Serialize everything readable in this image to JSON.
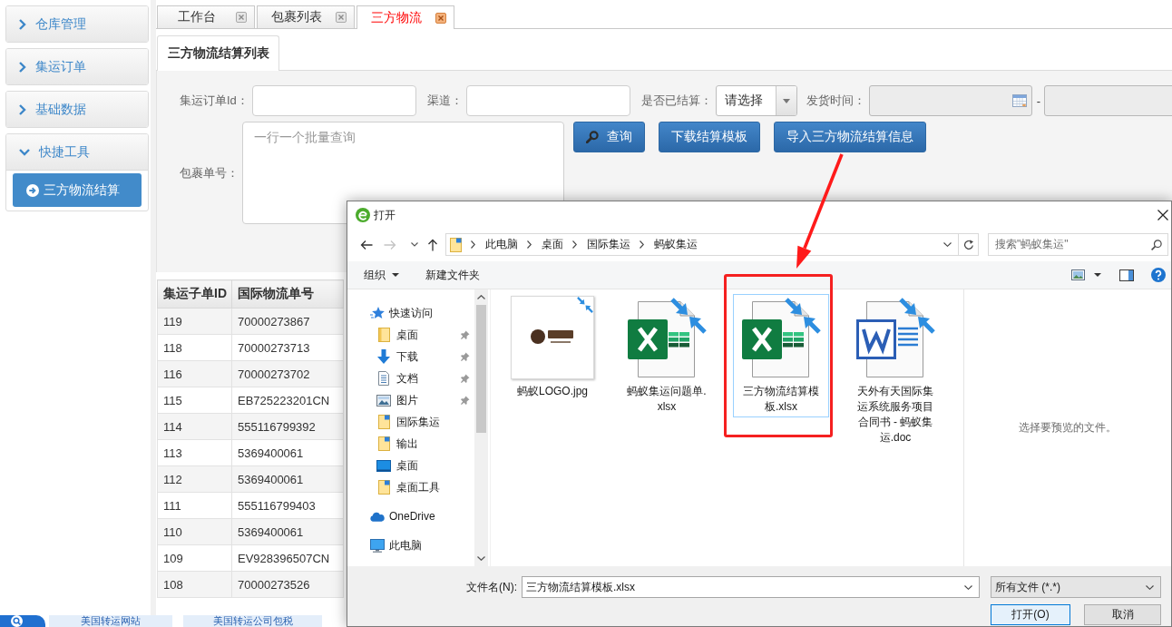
{
  "sidebar": {
    "panels": [
      {
        "title": "仓库管理",
        "expanded": false
      },
      {
        "title": "集运订单",
        "expanded": false
      },
      {
        "title": "基础数据",
        "expanded": false
      },
      {
        "title": "快捷工具",
        "expanded": true,
        "items": [
          {
            "label": "三方物流结算",
            "selected": true
          }
        ]
      }
    ]
  },
  "tabs": [
    {
      "label": "工作台",
      "selected": false
    },
    {
      "label": "包裹列表",
      "selected": false
    },
    {
      "label": "三方物流",
      "selected": true
    }
  ],
  "subtabs": [
    {
      "label": "三方物流结算列表",
      "selected": true
    }
  ],
  "filters": {
    "fields": [
      {
        "kind": "text",
        "label": "集运订单Id："
      },
      {
        "kind": "text",
        "label": "渠道："
      },
      {
        "kind": "select",
        "label": "是否已结算：",
        "value": "请选择"
      },
      {
        "kind": "date-range",
        "label": "发货时间：",
        "separator": "-",
        "disabled": true
      }
    ],
    "batch": {
      "label": "包裹单号：",
      "placeholder": "一行一个批量查询"
    },
    "buttons": [
      {
        "kind": "search",
        "label": "查询"
      },
      {
        "kind": "download",
        "label": "下载结算模板"
      },
      {
        "kind": "import",
        "label": "导入三方物流结算信息"
      }
    ]
  },
  "table": {
    "columns": [
      "集运子单ID",
      "国际物流单号"
    ],
    "rows": [
      [
        "119",
        "70000273867"
      ],
      [
        "118",
        "70000273713"
      ],
      [
        "116",
        "70000273702"
      ],
      [
        "115",
        "EB725223201CN"
      ],
      [
        "114",
        "555116799392"
      ],
      [
        "113",
        "5369400061"
      ],
      [
        "112",
        "5369400061"
      ],
      [
        "111",
        "555116799403"
      ],
      [
        "110",
        "5369400061"
      ],
      [
        "109",
        "EV928396507CN"
      ],
      [
        "108",
        "70000273526"
      ]
    ]
  },
  "bottom_bar": {
    "links": [
      "美国转运网站",
      "美国转运公司包税"
    ]
  },
  "dialog": {
    "title": "打开",
    "history": [
      {
        "kind": "back",
        "disabled": false
      },
      {
        "kind": "forward",
        "disabled": true
      }
    ],
    "path": [
      "此电脑",
      "桌面",
      "国际集运",
      "蚂蚁集运"
    ],
    "search": {
      "placeholder": "搜索\"蚂蚁集运\""
    },
    "toolbar": [
      {
        "kind": "menu",
        "label": "组织"
      },
      {
        "kind": "button",
        "label": "新建文件夹"
      }
    ],
    "navigation": [
      {
        "kind": "quick-access",
        "label": "快速访问",
        "children": [
          {
            "kind": "folder",
            "label": "桌面",
            "pinned": true
          },
          {
            "kind": "downloads",
            "label": "下载",
            "pinned": true
          },
          {
            "kind": "documents",
            "label": "文档",
            "pinned": true
          },
          {
            "kind": "pictures",
            "label": "图片",
            "pinned": true
          },
          {
            "kind": "folder-sync",
            "label": "国际集运",
            "pinned": false
          },
          {
            "kind": "folder-sync",
            "label": "输出",
            "pinned": false
          },
          {
            "kind": "desktop",
            "label": "桌面",
            "pinned": false
          },
          {
            "kind": "folder-sync",
            "label": "桌面工具",
            "pinned": false
          }
        ]
      },
      {
        "kind": "cloud",
        "label": "OneDrive"
      },
      {
        "kind": "computer",
        "label": "此电脑"
      }
    ],
    "files": [
      {
        "kind": "image",
        "name": "蚂蚁LOGO.jpg",
        "selected": false,
        "pending_sync": true
      },
      {
        "kind": "spreadsheet",
        "name": "蚂蚁集运问题单.xlsx",
        "selected": false,
        "pending_sync": true
      },
      {
        "kind": "spreadsheet",
        "name": "三方物流结算模板.xlsx",
        "selected": true,
        "pending_sync": true
      },
      {
        "kind": "document",
        "name": "天外有天国际集运系统服务项目合同书 - 蚂蚁集运.doc",
        "selected": false,
        "pending_sync": true
      }
    ],
    "preview": {
      "message": "选择要预览的文件。"
    },
    "footer": {
      "filename_label": "文件名(N):",
      "filename": "三方物流结算模板.xlsx",
      "file_type": "所有文件 (*.*)",
      "buttons": [
        {
          "kind": "primary",
          "label": "打开(O)"
        },
        {
          "kind": "secondary",
          "label": "取消"
        }
      ]
    }
  }
}
